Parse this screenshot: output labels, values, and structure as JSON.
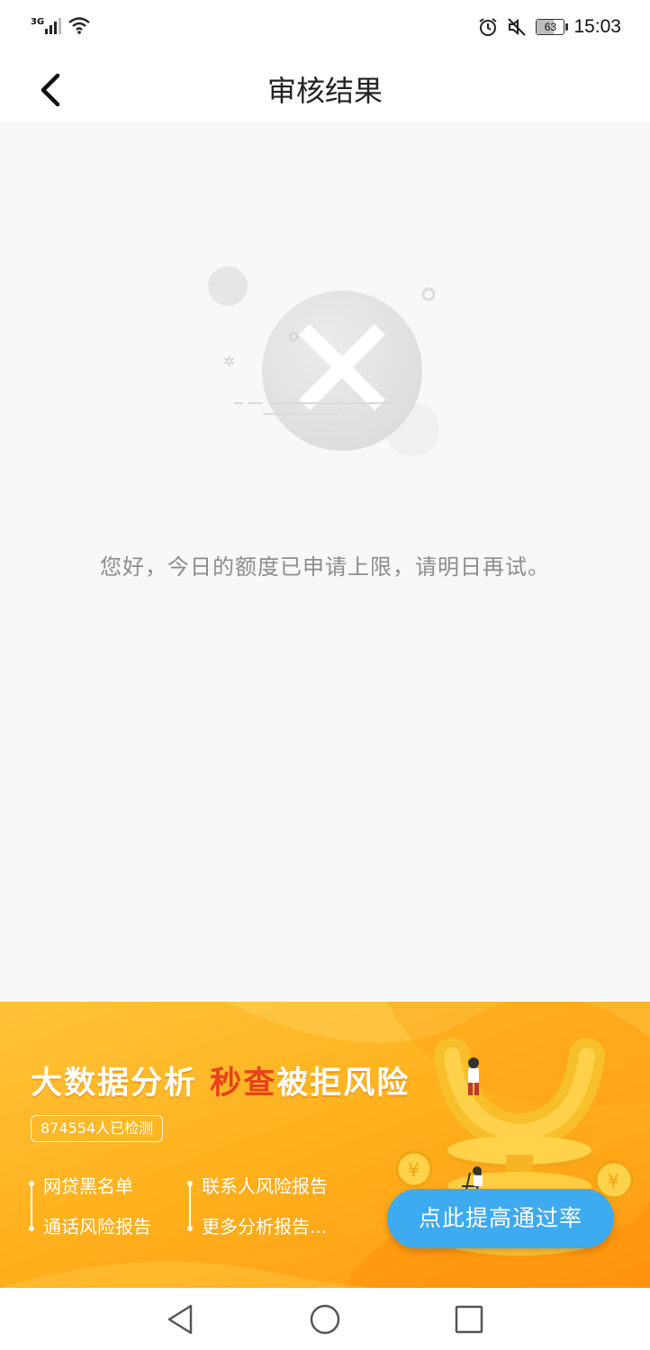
{
  "status_bar": {
    "network_type": "3G",
    "battery_level": "63",
    "time": "15:03",
    "icons": [
      "signal-icon",
      "wifi-icon",
      "alarm-icon",
      "mute-icon",
      "battery-icon"
    ]
  },
  "header": {
    "title": "审核结果",
    "back_icon": "chevron-left-icon"
  },
  "result": {
    "icon": "rejected-x-icon",
    "message": "您好，今日的额度已申请上限，请明日再试。"
  },
  "ad_banner": {
    "headline_part1": "大数据分析",
    "headline_part2": "秒查",
    "headline_part3": "被拒风险",
    "detected_count": "874554人已检测",
    "list_left": [
      "网贷黑名单",
      "通话风险报告"
    ],
    "list_right": [
      "联系人风险报告",
      "更多分析报告..."
    ],
    "cta_label": "点此提高通过率",
    "colors": {
      "background": "#ffb21e",
      "highlight": "#e8411c",
      "button": "#3eaaf0"
    }
  },
  "nav_bar": {
    "icons": [
      "back-triangle-icon",
      "home-circle-icon",
      "recents-square-icon"
    ]
  }
}
